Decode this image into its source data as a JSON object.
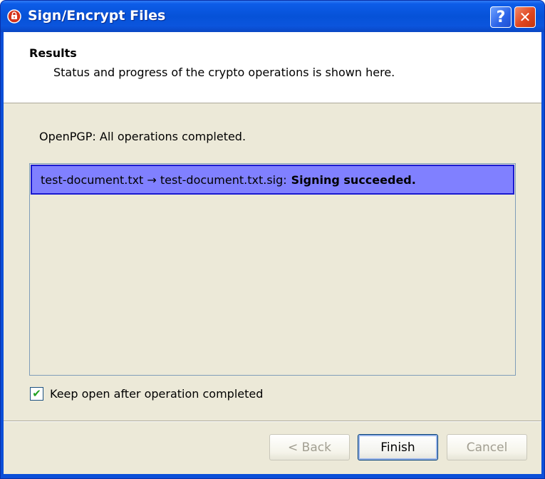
{
  "window": {
    "title": "Sign/Encrypt Files",
    "help_glyph": "?",
    "close_glyph": "✕",
    "app_icon": "kleopatra-app-icon"
  },
  "header": {
    "title": "Results",
    "subtitle": "Status and progress of the crypto operations is shown here."
  },
  "status": {
    "text": "OpenPGP: All operations completed."
  },
  "results": [
    {
      "prefix": "test-document.txt → test-document.txt.sig:",
      "status": "Signing succeeded."
    }
  ],
  "keep_open": {
    "label": "Keep open after operation completed",
    "checked": true,
    "check_glyph": "✔"
  },
  "buttons": {
    "back": "< Back",
    "finish": "Finish",
    "cancel": "Cancel"
  },
  "colors": {
    "titlebar": "#0652d8",
    "selection": "#8080ff",
    "dialog_bg": "#ece9d8"
  }
}
